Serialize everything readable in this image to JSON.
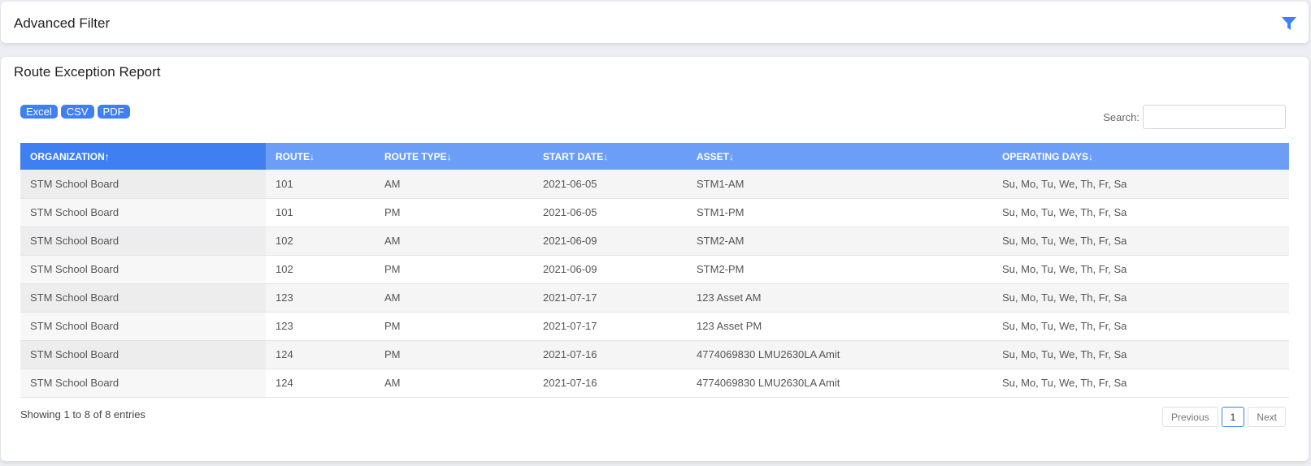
{
  "advanced_filter": {
    "title": "Advanced Filter",
    "icon": "filter-icon",
    "accent": "#3f7ff2"
  },
  "report": {
    "title": "Route Exception Report",
    "exports": [
      "Excel",
      "CSV",
      "PDF"
    ],
    "search": {
      "label": "Search:",
      "value": "",
      "placeholder": ""
    },
    "columns": [
      {
        "label": "ORGANIZATION",
        "sort": "↑"
      },
      {
        "label": "ROUTE",
        "sort": "↓"
      },
      {
        "label": "ROUTE TYPE",
        "sort": "↓"
      },
      {
        "label": "START DATE",
        "sort": "↓"
      },
      {
        "label": "ASSET",
        "sort": "↓"
      },
      {
        "label": "OPERATING DAYS",
        "sort": "↓"
      }
    ],
    "rows": [
      [
        "STM School Board",
        "101",
        "AM",
        "2021-06-05",
        "STM1-AM",
        "Su, Mo, Tu, We, Th, Fr, Sa"
      ],
      [
        "STM School Board",
        "101",
        "PM",
        "2021-06-05",
        "STM1-PM",
        "Su, Mo, Tu, We, Th, Fr, Sa"
      ],
      [
        "STM School Board",
        "102",
        "AM",
        "2021-06-09",
        "STM2-AM",
        "Su, Mo, Tu, We, Th, Fr, Sa"
      ],
      [
        "STM School Board",
        "102",
        "PM",
        "2021-06-09",
        "STM2-PM",
        "Su, Mo, Tu, We, Th, Fr, Sa"
      ],
      [
        "STM School Board",
        "123",
        "AM",
        "2021-07-17",
        "123 Asset AM",
        "Su, Mo, Tu, We, Th, Fr, Sa"
      ],
      [
        "STM School Board",
        "123",
        "PM",
        "2021-07-17",
        "123 Asset PM",
        "Su, Mo, Tu, We, Th, Fr, Sa"
      ],
      [
        "STM School Board",
        "124",
        "PM",
        "2021-07-16",
        "4774069830 LMU2630LA Amit",
        "Su, Mo, Tu, We, Th, Fr, Sa"
      ],
      [
        "STM School Board",
        "124",
        "AM",
        "2021-07-16",
        "4774069830 LMU2630LA Amit",
        "Su, Mo, Tu, We, Th, Fr, Sa"
      ]
    ],
    "info": "Showing 1 to 8 of 8 entries",
    "pagination": {
      "previous": "Previous",
      "current": "1",
      "next": "Next"
    }
  }
}
